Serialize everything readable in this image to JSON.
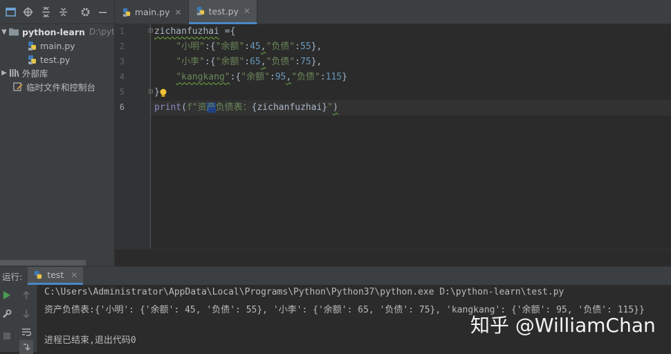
{
  "project_pane": {
    "toolbar_icons": [
      "project-view-icon",
      "locate-icon",
      "expand-all-icon",
      "collapse-all-icon",
      "settings-icon",
      "hide-icon"
    ],
    "tree": {
      "root_name": "python-learn",
      "root_path": "D:\\pyth",
      "files": [
        "main.py",
        "test.py"
      ],
      "external_libs": "外部库",
      "scratches": "临时文件和控制台"
    }
  },
  "tabs": [
    {
      "label": "main.py",
      "active": false
    },
    {
      "label": "test.py",
      "active": true
    }
  ],
  "editor": {
    "line_numbers": [
      "1",
      "2",
      "3",
      "4",
      "5",
      "6"
    ],
    "current_line": 6,
    "lines": [
      {
        "segments": [
          {
            "t": "zichanfuzhai",
            "c": "v sq"
          },
          {
            "t": " ={",
            "c": "v"
          }
        ]
      },
      {
        "segments": [
          {
            "t": "    ",
            "c": "v"
          },
          {
            "t": "\"小明\"",
            "c": "s"
          },
          {
            "t": ":{",
            "c": "v"
          },
          {
            "t": "\"余额\"",
            "c": "s"
          },
          {
            "t": ":",
            "c": "v"
          },
          {
            "t": "45",
            "c": "n"
          },
          {
            "t": ",",
            "c": "v sq"
          },
          {
            "t": "\"负债\"",
            "c": "s"
          },
          {
            "t": ":",
            "c": "v"
          },
          {
            "t": "55",
            "c": "n"
          },
          {
            "t": "},",
            "c": "v"
          }
        ]
      },
      {
        "segments": [
          {
            "t": "    ",
            "c": "v"
          },
          {
            "t": "\"小李\"",
            "c": "s"
          },
          {
            "t": ":{",
            "c": "v"
          },
          {
            "t": "\"余额\"",
            "c": "s"
          },
          {
            "t": ":",
            "c": "v"
          },
          {
            "t": "65",
            "c": "n"
          },
          {
            "t": ",",
            "c": "v sq"
          },
          {
            "t": "\"负债\"",
            "c": "s"
          },
          {
            "t": ":",
            "c": "v"
          },
          {
            "t": "75",
            "c": "n"
          },
          {
            "t": "},",
            "c": "v"
          }
        ]
      },
      {
        "segments": [
          {
            "t": "    ",
            "c": "v"
          },
          {
            "t": "\"kangkang\"",
            "c": "s sq"
          },
          {
            "t": ":{",
            "c": "v"
          },
          {
            "t": "\"余额\"",
            "c": "s"
          },
          {
            "t": ":",
            "c": "v"
          },
          {
            "t": "95",
            "c": "n"
          },
          {
            "t": ",",
            "c": "v sq"
          },
          {
            "t": "\"负债\"",
            "c": "s"
          },
          {
            "t": ":",
            "c": "v"
          },
          {
            "t": "115",
            "c": "n"
          },
          {
            "t": "}",
            "c": "v"
          }
        ]
      },
      {
        "segments": [
          {
            "t": "}",
            "c": "v"
          }
        ]
      },
      {
        "segments": [
          {
            "t": "print",
            "c": "b"
          },
          {
            "t": "(",
            "c": "v"
          },
          {
            "t": "f\"资",
            "c": "s"
          },
          {
            "t": "产",
            "c": "s sel"
          },
          {
            "t": "负债表：",
            "c": "s"
          },
          {
            "t": "{zichanfuzhai}",
            "c": "v"
          },
          {
            "t": "\"",
            "c": "s"
          },
          {
            "t": ")",
            "c": "v sq"
          }
        ]
      }
    ]
  },
  "run_panel": {
    "label": "运行:",
    "tab_label": "test",
    "output": [
      "C:\\Users\\Administrator\\AppData\\Local\\Programs\\Python\\Python37\\python.exe D:\\python-learn\\test.py",
      "资产负债表:{'小明': {'余额': 45, '负债': 55}, '小李': {'余额': 65, '负债': 75}, 'kangkang': {'余额': 95, '负债': 115}}",
      "",
      "进程已结束,退出代码0"
    ]
  },
  "watermark": "知乎 @WilliamChan",
  "colors": {
    "accent": "#4a88c7",
    "string": "#6a8759",
    "number": "#6897bb",
    "builtin": "#8888c6"
  }
}
